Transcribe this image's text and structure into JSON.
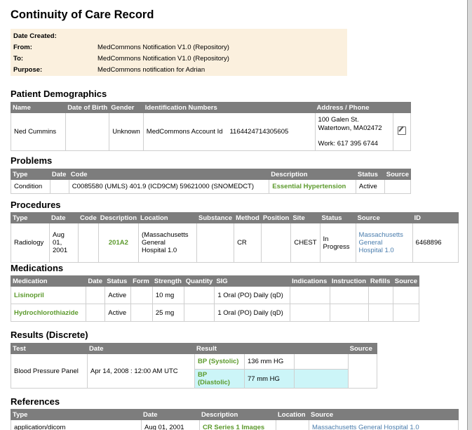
{
  "title": "Continuity of Care Record",
  "header": {
    "date_created_label": "Date Created:",
    "from_label": "From:",
    "from_value": "MedCommons Notification V1.0 (Repository)",
    "to_label": "To:",
    "to_value": "MedCommons Notification V1.0 (Repository)",
    "purpose_label": "Purpose:",
    "purpose_value": "MedCommons notification for Adrian"
  },
  "demographics": {
    "heading": "Patient Demographics",
    "columns": [
      "Name",
      "Date of Birth",
      "Gender",
      "Identification Numbers",
      "Address / Phone"
    ],
    "row": {
      "name": "Ned Cummins",
      "gender": "Unknown",
      "id_label": "MedCommons Account Id",
      "id_value": "1164424714305605",
      "address1": "100 Galen St.",
      "address2": "Watertown, MA02472",
      "phone": "Work: 617 395 6744"
    },
    "edit_icon": "edit-icon"
  },
  "problems": {
    "heading": "Problems",
    "columns": [
      "Type",
      "Date",
      "Code",
      "Description",
      "Status",
      "Source"
    ],
    "rows": [
      {
        "type": "Condition",
        "code": "C0085580 (UMLS) 401.9 (ICD9CM) 59621000 (SNOMEDCT)",
        "description": "Essential Hypertension",
        "status": "Active"
      }
    ]
  },
  "procedures": {
    "heading": "Procedures",
    "columns": [
      "Type",
      "Date",
      "Code",
      "Description",
      "Location",
      "Substance",
      "Method",
      "Position",
      "Site",
      "Status",
      "Source",
      "ID"
    ],
    "rows": [
      {
        "type": "Radiology",
        "date1": "Aug",
        "date2": "01,",
        "date3": "2001",
        "description": "201A2",
        "loc1": "(Massachusetts",
        "loc2": "General",
        "loc3": "Hospital 1.0",
        "method": "CR",
        "site": "CHEST",
        "status1": "In",
        "status2": "Progress",
        "src1": "Massachusetts",
        "src2": "General",
        "src3": "Hospital 1.0",
        "id": "6468896"
      }
    ]
  },
  "medications": {
    "heading": "Medications",
    "columns": [
      "Medication",
      "Date",
      "Status",
      "Form",
      "Strength",
      "Quantity",
      "SIG",
      "Indications",
      "Instruction",
      "Refills",
      "Source"
    ],
    "rows": [
      {
        "name": "Lisinopril",
        "status": "Active",
        "strength": "10 mg",
        "sig": "1 Oral (PO) Daily (qD)"
      },
      {
        "name": "Hydrochlorothiazide",
        "status": "Active",
        "strength": "25 mg",
        "sig": "1 Oral (PO) Daily (qD)"
      }
    ]
  },
  "results": {
    "heading": "Results (Discrete)",
    "columns": [
      "Test",
      "Date",
      "Result",
      "Source"
    ],
    "row": {
      "test": "Blood Pressure Panel",
      "date": "Apr 14, 2008 : 12:00 AM UTC",
      "r1_name": "BP (Systolic)",
      "r1_value": "136 mm HG",
      "r2_name1": "BP",
      "r2_name2": "(Diastolic)",
      "r2_value": "77 mm HG"
    }
  },
  "references": {
    "heading": "References",
    "columns": [
      "Type",
      "Date",
      "Description",
      "Location",
      "Source"
    ],
    "row": {
      "type": "application/dicom",
      "date": "Aug 01, 2001",
      "description": "CR Series 1 Images",
      "source": "Massachusetts General Hospital 1.0"
    }
  }
}
